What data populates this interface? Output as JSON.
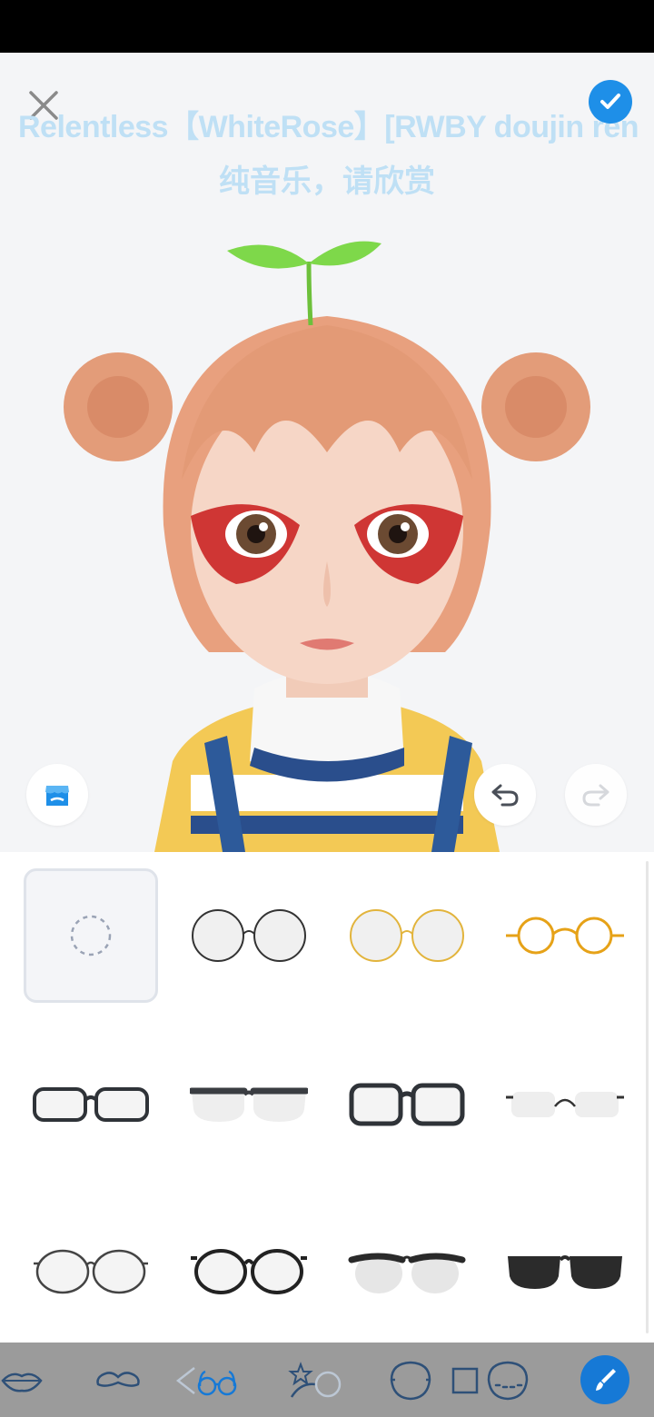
{
  "lyrics": {
    "line1": "Relentless【WhiteRose】[RWBY doujin ren",
    "line2": "纯音乐，请欣赏"
  },
  "header": {
    "close_icon": "close-icon",
    "confirm_icon": "check-icon"
  },
  "controls": {
    "store_icon": "store-icon",
    "undo_icon": "undo-icon",
    "redo_icon": "redo-icon"
  },
  "glasses_items": [
    {
      "id": "none",
      "style": "empty",
      "selected": true
    },
    {
      "id": "round-thin-black",
      "style": "round-thin",
      "color": "#333333"
    },
    {
      "id": "round-thin-gold",
      "style": "round-thin",
      "color": "#e2b43c"
    },
    {
      "id": "round-small-orange",
      "style": "round-small",
      "color": "#e6a218"
    },
    {
      "id": "rect-black",
      "style": "rect",
      "color": "#2f3338"
    },
    {
      "id": "browline-rect",
      "style": "browline-rect",
      "color": "#3a3d42"
    },
    {
      "id": "square-thick",
      "style": "square-thick",
      "color": "#2f3338"
    },
    {
      "id": "rimless",
      "style": "rimless",
      "color": "#333333"
    },
    {
      "id": "round-medium-grey",
      "style": "round-medium",
      "color": "#444444"
    },
    {
      "id": "round-thick-black",
      "style": "round-thick",
      "color": "#222222"
    },
    {
      "id": "browline-round",
      "style": "browline-round",
      "color": "#2a2a2a"
    },
    {
      "id": "sunglasses",
      "style": "sunglasses",
      "color": "#2b2b2b"
    }
  ],
  "bottom_tabs": [
    {
      "id": "lips",
      "icon": "lips-icon"
    },
    {
      "id": "mustache",
      "icon": "mustache-icon"
    },
    {
      "id": "glasses",
      "icon": "glasses-icon"
    },
    {
      "id": "face-accessory",
      "icon": "sparkle-face-icon"
    },
    {
      "id": "face-shape",
      "icon": "face-shape-icon"
    },
    {
      "id": "background",
      "icon": "square-icon"
    },
    {
      "id": "face-pattern",
      "icon": "face-dots-icon"
    },
    {
      "id": "paint",
      "icon": "paint-brush-icon",
      "active": true
    }
  ],
  "colors": {
    "accent": "#1e8fe8",
    "active_tab": "#1679d6",
    "bottom_bar": "#9b9b9b",
    "lyric_text": "#bfe0f5"
  }
}
